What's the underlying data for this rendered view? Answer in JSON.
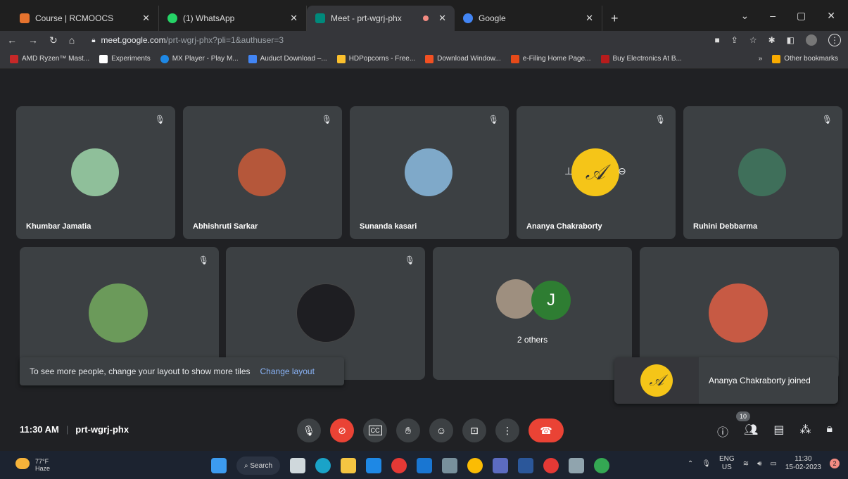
{
  "tabs": [
    {
      "title": "Course | RCMOOCS",
      "color": "#e6732e"
    },
    {
      "title": "(1) WhatsApp",
      "color": "#25d366"
    },
    {
      "title": "Meet - prt-wgrj-phx",
      "color": "#00897b"
    },
    {
      "title": "Google",
      "color": "#4285f4"
    }
  ],
  "new_tab": "+",
  "window": {
    "minimize": "–",
    "maximize": "▢",
    "close": "✕",
    "dropdown": "⌄"
  },
  "omnibox": {
    "host": "meet.google.com",
    "path": "/prt-wgrj-phx?pli=1&authuser=3"
  },
  "bookmarks": [
    {
      "label": "AMD Ryzen™ Mast...",
      "color": "#c62828"
    },
    {
      "label": "Experiments",
      "color": "#ffffff"
    },
    {
      "label": "MX Player - Play M...",
      "color": "#1e88e5"
    },
    {
      "label": "Auduct Download –...",
      "color": "#4285f4"
    },
    {
      "label": "HDPopcorns - Free...",
      "color": "#fbc02d"
    },
    {
      "label": "Download Window...",
      "color": "#f25022"
    },
    {
      "label": "e-Filing Home Page...",
      "color": "#e64a19"
    },
    {
      "label": "Buy Electronics At B...",
      "color": "#b71c1c"
    }
  ],
  "bookmarks_more": "»",
  "other_bookmarks": "Other bookmarks",
  "participants": [
    {
      "name": "Khumbar Jamatia",
      "color": "#8fbf9a"
    },
    {
      "name": "Abhishruti Sarkar",
      "color": "#b5573a"
    },
    {
      "name": "Sunanda kasari",
      "color": "#7fa9c9"
    },
    {
      "name": "Ananya Chakraborty",
      "color": "#f5c518"
    },
    {
      "name": "Ruhini Debbarma",
      "color": "#3f6f5a"
    },
    {
      "name": "",
      "color": "#6b9a5a"
    },
    {
      "name": "",
      "color": "#1e1e22"
    },
    {
      "name": "",
      "color": "#c75a44"
    }
  ],
  "monogram": "𝒜",
  "others": {
    "initial": "J",
    "label": "2 others"
  },
  "layout_hint": {
    "text": "To see more people, change your layout to show more tiles",
    "link": "Change layout"
  },
  "toast": {
    "text": "Ananya Chakraborty joined"
  },
  "meeting": {
    "time": "11:30 AM",
    "code": "prt-wgrj-phx"
  },
  "people_count": "10",
  "taskbar": {
    "temp": "77°F",
    "weather": "Haze",
    "search": "Search",
    "lang_top": "ENG",
    "lang_bottom": "US",
    "time": "11:30",
    "date": "15-02-2023",
    "notifications": "2"
  }
}
